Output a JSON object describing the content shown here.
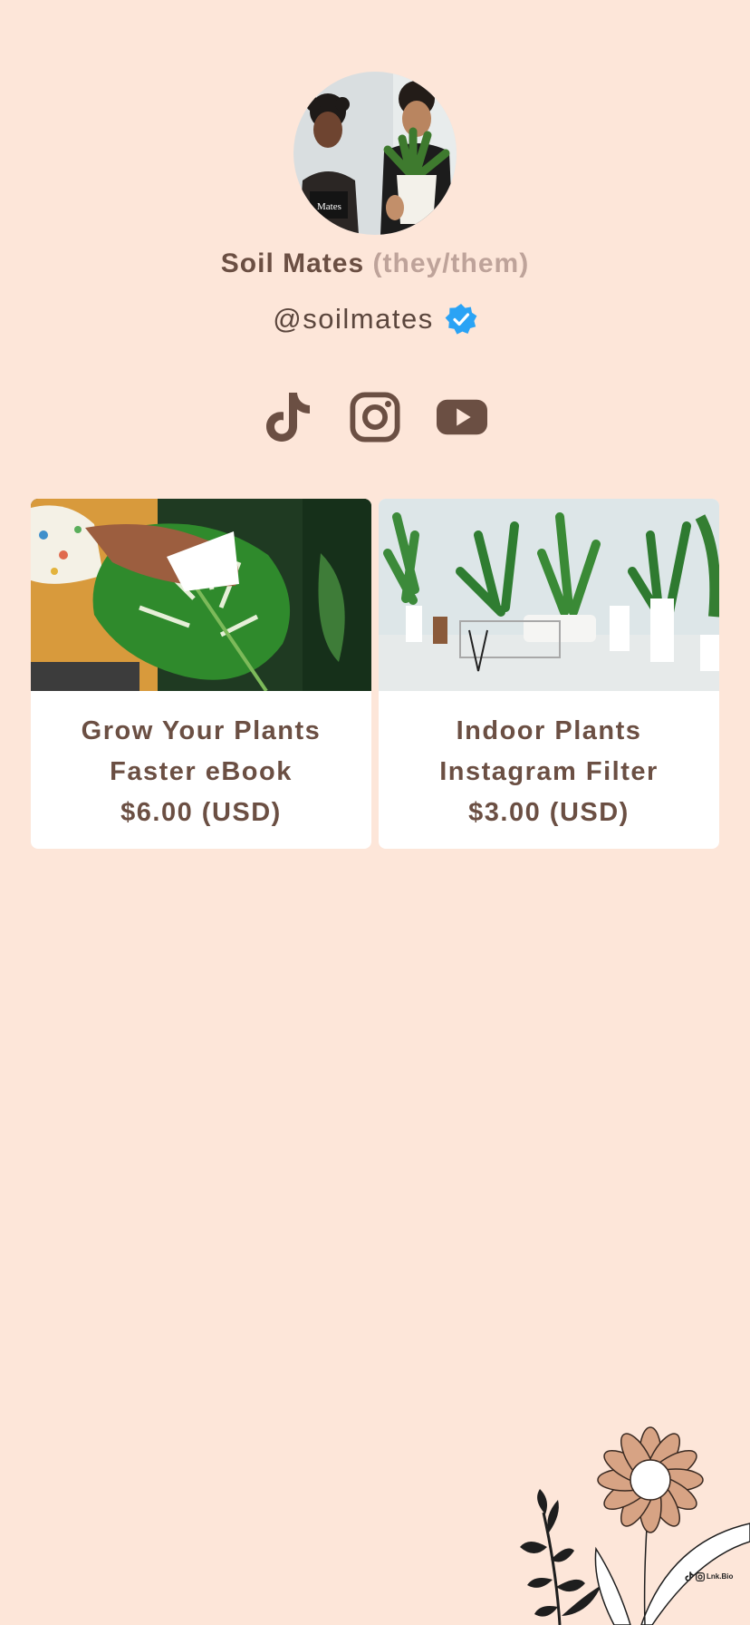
{
  "profile": {
    "name": "Soil Mates",
    "pronouns": "(they/them)",
    "handle": "@soilmates",
    "verified": true,
    "avatar_alt": "Soil Mates"
  },
  "social": [
    {
      "platform": "TikTok",
      "icon": "tiktok-icon"
    },
    {
      "platform": "Instagram",
      "icon": "instagram-icon"
    },
    {
      "platform": "YouTube",
      "icon": "youtube-icon"
    }
  ],
  "products": [
    {
      "title_line1": "Grow Your Plants",
      "title_line2": "Faster eBook",
      "price": "$6.00 (USD)",
      "image": "monstera-leaf-cleaning"
    },
    {
      "title_line1": "Indoor Plants",
      "title_line2": "Instagram Filter",
      "price": "$3.00 (USD)",
      "image": "indoor-plants-room"
    }
  ],
  "footer": {
    "brand": "Lnk.Bio"
  },
  "colors": {
    "background": "#FDE6D9",
    "primary_text": "#6B4F43",
    "muted_text": "#BEA39A",
    "card_background": "#FFFFFF",
    "verified_blue": "#2AA3F5",
    "flower_petal": "#D7A384"
  }
}
